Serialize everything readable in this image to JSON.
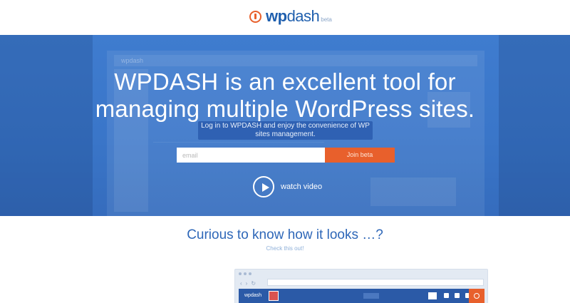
{
  "brand": {
    "name_bold": "wp",
    "name_regular": "dash",
    "badge": "beta",
    "accent_color": "#e8602c",
    "primary_color": "#1f5fae"
  },
  "hero": {
    "title_line1": "WPDASH is an excellent tool for",
    "title_line2": "managing multiple WordPress sites.",
    "subtitle": "Log in to WPDASH and enjoy the convenience of WP sites management.",
    "email_placeholder": "email",
    "join_button": "Join beta",
    "watch_video": "watch video",
    "background_color": "#3a76c9"
  },
  "curious": {
    "title": "Curious to know how it looks …?",
    "subtitle": "Check this out!"
  },
  "preview": {
    "app_logo": "wpdash",
    "icons": [
      "play-icon",
      "browser-back-icon",
      "browser-forward-icon",
      "reload-icon",
      "power-icon"
    ]
  }
}
